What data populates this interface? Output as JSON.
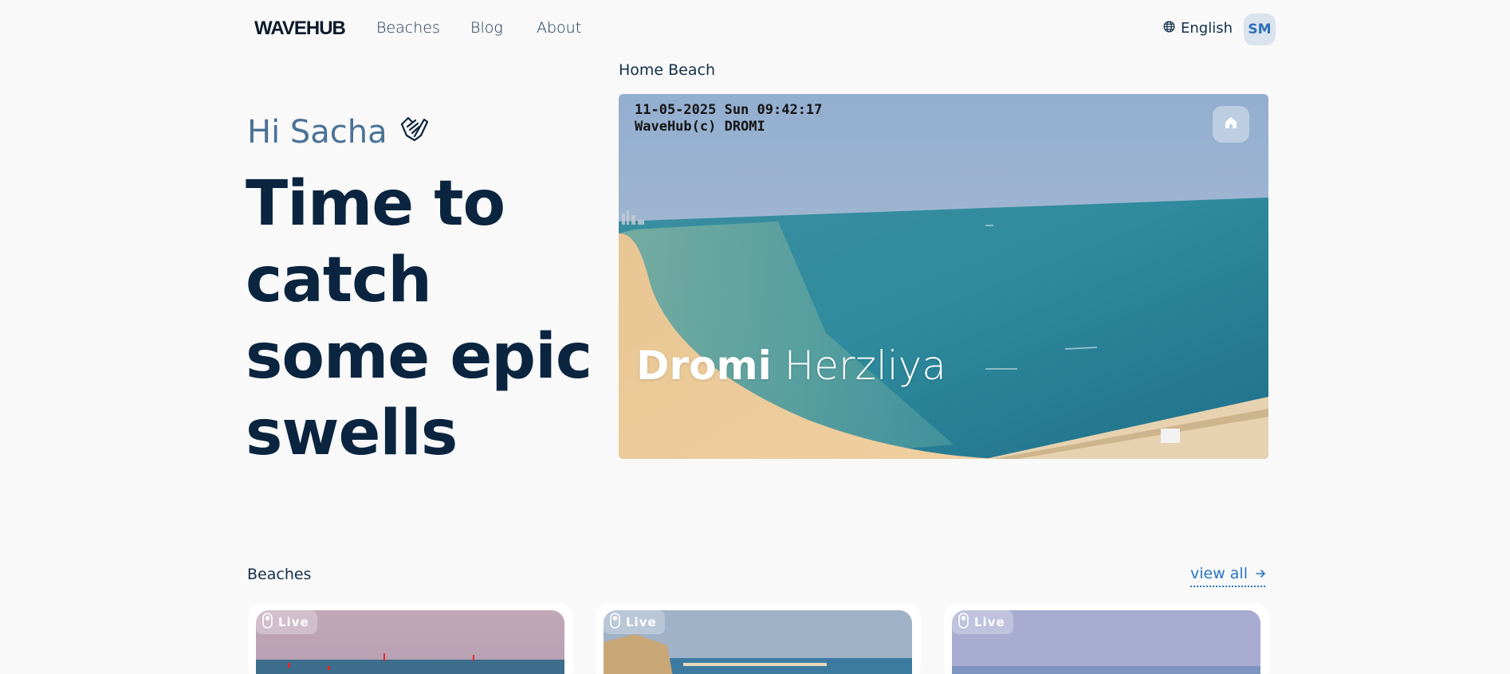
{
  "nav": {
    "logo": "WAVEHUB",
    "links": [
      {
        "label": "Beaches"
      },
      {
        "label": "Blog"
      },
      {
        "label": "About"
      }
    ],
    "language": "English",
    "avatar_initials": "SM"
  },
  "hero": {
    "greeting": "Hi Sacha",
    "greeting_icon": "shaka-hand-icon",
    "headline": "Time to catch some epic swells"
  },
  "home_beach": {
    "section_label": "Home Beach",
    "cam_timestamp": "11-05-2025 Sun 09:42:17",
    "cam_caption": "WaveHub(c) DROMI",
    "beach_name_bold": "Dromi",
    "beach_name_light": "Herzliya",
    "home_icon": "home-icon"
  },
  "beaches": {
    "section_label": "Beaches",
    "view_all_label": "view all",
    "cards": [
      {
        "badge": "Live"
      },
      {
        "badge": "Live"
      },
      {
        "badge": "Live"
      }
    ]
  },
  "colors": {
    "background": "#f9f9f9",
    "headline": "#0b2540",
    "greeting": "#4a7296",
    "accent_link": "#2a76c4",
    "avatar_bg": "#dbe4ee"
  }
}
